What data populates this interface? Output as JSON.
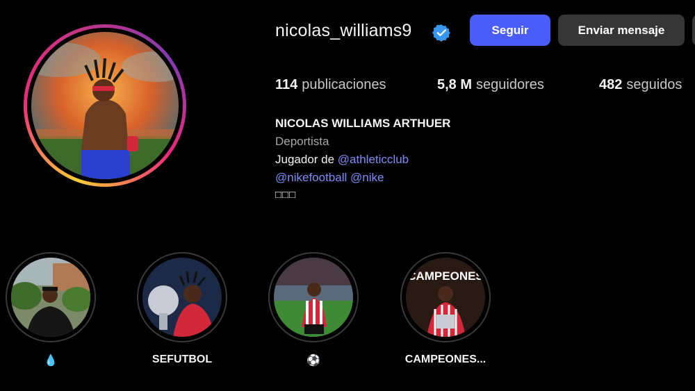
{
  "profile": {
    "username": "nicolas_williams9",
    "verified": true,
    "full_name": "NICOLAS WILLIAMS ARTHUER",
    "category": "Deportista",
    "bio_prefix": "Jugador de ",
    "bio_mentions_line1": "@athleticclub",
    "bio_mentions_line2a": "@nikefootball",
    "bio_mentions_line2b": "@nike",
    "bio_line3": "□□□"
  },
  "actions": {
    "follow_label": "Seguir",
    "message_label": "Enviar mensaje"
  },
  "stats": {
    "posts_count": "114",
    "posts_label": "publicaciones",
    "followers_count": "5,8 M",
    "followers_label": "seguidores",
    "following_count": "482",
    "following_label": "seguidos"
  },
  "highlights": [
    {
      "label": "💧",
      "icon": "water-drop-icon"
    },
    {
      "label": "SEFUTBOL"
    },
    {
      "label": "⚽",
      "icon": "soccer-ball-icon"
    },
    {
      "label": "CAMPEONES...",
      "cover_text": "CAMPEONES"
    }
  ],
  "colors": {
    "background": "#000000",
    "follow_button": "#4a5df9",
    "secondary_button": "#363636",
    "link": "#7e8ef7",
    "verified_badge": "#3797f0"
  }
}
